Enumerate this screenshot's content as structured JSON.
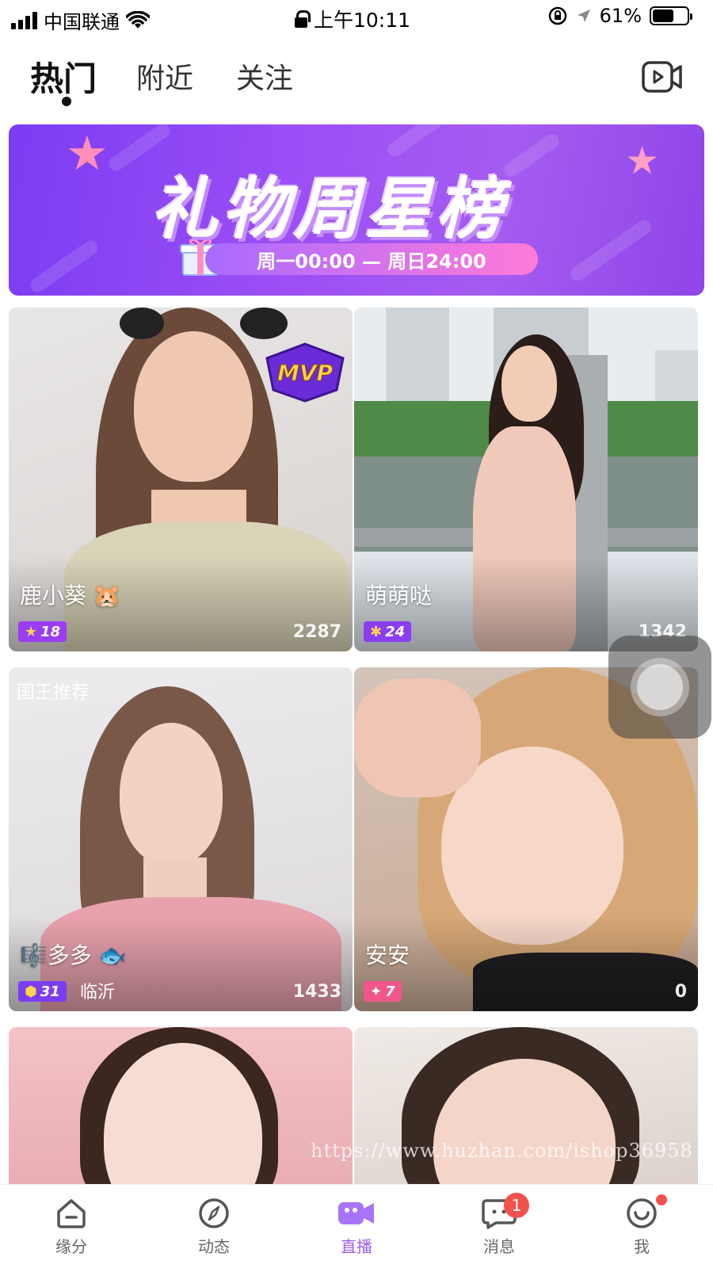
{
  "status_bar": {
    "carrier": "中国联通",
    "time": "上午10:11",
    "battery": "61%",
    "battery_level": 0.61
  },
  "top_tabs": [
    {
      "label": "热门",
      "active": true
    },
    {
      "label": "附近",
      "active": false
    },
    {
      "label": "关注",
      "active": false
    }
  ],
  "banner": {
    "title": "礼物周星榜",
    "subtitle": "周一00:00 — 周日24:00",
    "page_count": 4,
    "active_page": 2
  },
  "cards": [
    {
      "name": "鹿小葵",
      "emoji": "🐹",
      "level": "18",
      "level_color": "#9b3df2",
      "count": "2287",
      "city": "",
      "recommend": "",
      "mvp": "MVP"
    },
    {
      "name": "萌萌哒",
      "emoji": "",
      "level": "24",
      "level_color": "#8a3df2",
      "count": "1342",
      "city": "",
      "recommend": "",
      "mvp": ""
    },
    {
      "name": "多多",
      "emoji": "🐟",
      "level": "31",
      "level_color": "#7b3df2",
      "count": "1433",
      "city": "临沂",
      "recommend": "国王推荐",
      "mvp": ""
    },
    {
      "name": "安安",
      "emoji": "",
      "level": "7",
      "level_color": "#f0558c",
      "count": "0",
      "city": "",
      "recommend": "",
      "mvp": ""
    }
  ],
  "watermark": "https://www.huzhan.com/ishop36958",
  "bottom_nav": [
    {
      "label": "缘分",
      "icon": "home-icon",
      "active": false
    },
    {
      "label": "动态",
      "icon": "compass-icon",
      "active": false
    },
    {
      "label": "直播",
      "icon": "video-camera-icon",
      "active": true
    },
    {
      "label": "消息",
      "icon": "message-icon",
      "active": false,
      "badge": "1"
    },
    {
      "label": "我",
      "icon": "smile-face-icon",
      "active": false
    }
  ],
  "colors": {
    "accent": "#9b5cf6",
    "badge_red": "#f2524b",
    "banner_purple": "#8f45e8"
  }
}
